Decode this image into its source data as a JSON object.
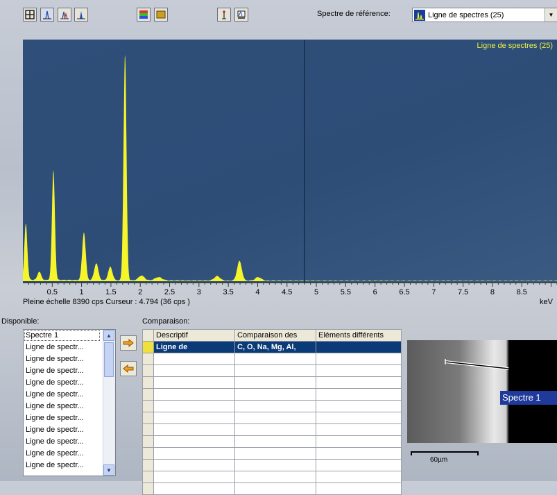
{
  "toolbar": {
    "buttons": [
      {
        "icon": "grid-icon"
      },
      {
        "icon": "peak-outline-icon"
      },
      {
        "icon": "peak-overlay-icon"
      },
      {
        "icon": "peak-filled-icon"
      },
      {
        "icon": "color-palette-icon"
      },
      {
        "icon": "fill-color-icon"
      },
      {
        "icon": "marker-icon"
      },
      {
        "icon": "export-spectrum-icon"
      }
    ],
    "reference_label": "Spectre de référence:",
    "reference_value": "Ligne de spectres (25)",
    "reference_icon": "spectrum-icon"
  },
  "spectrum": {
    "legend": "Ligne de spectres (25)",
    "status": "Pleine échelle 8390 cps  Curseur : 4.794  (36 cps )",
    "unit": "keV",
    "full_scale_cps": 8390,
    "cursor_kev": 4.794,
    "colors": {
      "background": "#2e4e78",
      "trace": "#f5f52a",
      "cursor": "#0b1a33"
    }
  },
  "chart_data": {
    "type": "area",
    "xlim": [
      0,
      9.1
    ],
    "ylim": [
      0,
      8390
    ],
    "x_ticks": [
      "0.5",
      "1",
      "1.5",
      "2",
      "2.5",
      "3",
      "3.5",
      "4",
      "4.5",
      "5",
      "5.5",
      "6",
      "6.5",
      "7",
      "7.5",
      "8",
      "8.5"
    ],
    "xlabel": "keV",
    "cursor": 4.794,
    "peaks": [
      {
        "x": 0.05,
        "y": 2000,
        "w": 0.025
      },
      {
        "x": 0.28,
        "y": 290,
        "w": 0.03
      },
      {
        "x": 0.52,
        "y": 3900,
        "w": 0.025
      },
      {
        "x": 1.04,
        "y": 1700,
        "w": 0.03
      },
      {
        "x": 1.25,
        "y": 600,
        "w": 0.035
      },
      {
        "x": 1.49,
        "y": 480,
        "w": 0.035
      },
      {
        "x": 1.74,
        "y": 8040,
        "w": 0.025
      },
      {
        "x": 2.02,
        "y": 170,
        "w": 0.05
      },
      {
        "x": 2.31,
        "y": 120,
        "w": 0.06
      },
      {
        "x": 3.31,
        "y": 160,
        "w": 0.05
      },
      {
        "x": 3.69,
        "y": 700,
        "w": 0.04
      },
      {
        "x": 4.01,
        "y": 130,
        "w": 0.05
      }
    ],
    "baseline": 45
  },
  "available": {
    "label": "Disponible:",
    "items": [
      "Spectre 1",
      "Ligne de spectr...",
      "Ligne de spectr...",
      "Ligne de spectr...",
      "Ligne de spectr...",
      "Ligne de spectr...",
      "Ligne de spectr...",
      "Ligne de spectr...",
      "Ligne de spectr...",
      "Ligne de spectr...",
      "Ligne de spectr...",
      "Ligne de spectr..."
    ]
  },
  "comparison": {
    "label": "Comparaison:",
    "columns": [
      "Descriptif",
      "Comparaison des",
      "Eléments différents"
    ],
    "rows": [
      [
        "Ligne de",
        "C, O, Na, Mg, Al,",
        ""
      ],
      [
        "",
        "",
        ""
      ],
      [
        "",
        "",
        ""
      ],
      [
        "",
        "",
        ""
      ],
      [
        "",
        "",
        ""
      ],
      [
        "",
        "",
        ""
      ],
      [
        "",
        "",
        ""
      ],
      [
        "",
        "",
        ""
      ],
      [
        "",
        "",
        ""
      ],
      [
        "",
        "",
        ""
      ],
      [
        "",
        "",
        ""
      ],
      [
        "",
        "",
        ""
      ],
      [
        "",
        "",
        ""
      ]
    ]
  },
  "image": {
    "tag": "Spectre 1",
    "scale": "60µm"
  }
}
